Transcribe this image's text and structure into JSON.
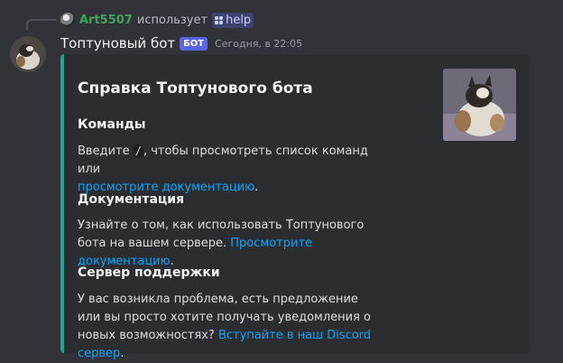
{
  "reply": {
    "username": "Art5507",
    "verb": "использует",
    "command": "help"
  },
  "message": {
    "author": "Топтуновый бот",
    "bot_tag": "БОТ",
    "timestamp": "Сегодня, в 22:05"
  },
  "embed": {
    "accent_color": "#1fa68a",
    "title": "Справка Топтунового бота",
    "fields": [
      {
        "name": "Команды",
        "text_before": "Введите",
        "code": "/",
        "text_after": ", чтобы просмотреть список команд или",
        "link": "просмотрите документацию",
        "end": "."
      },
      {
        "name": "Документация",
        "text_before": "Узнайте о том, как использовать Топтунового бота на вашем сервере.",
        "link": "Просмотрите документацию",
        "end": "."
      },
      {
        "name": "Сервер поддержки",
        "text_before": "У вас возникла проблема, есть предложение или вы просто хотите получать уведомления о новых возможностях?",
        "link": "Вступайте в наш Discord сервер",
        "end": "."
      }
    ]
  }
}
